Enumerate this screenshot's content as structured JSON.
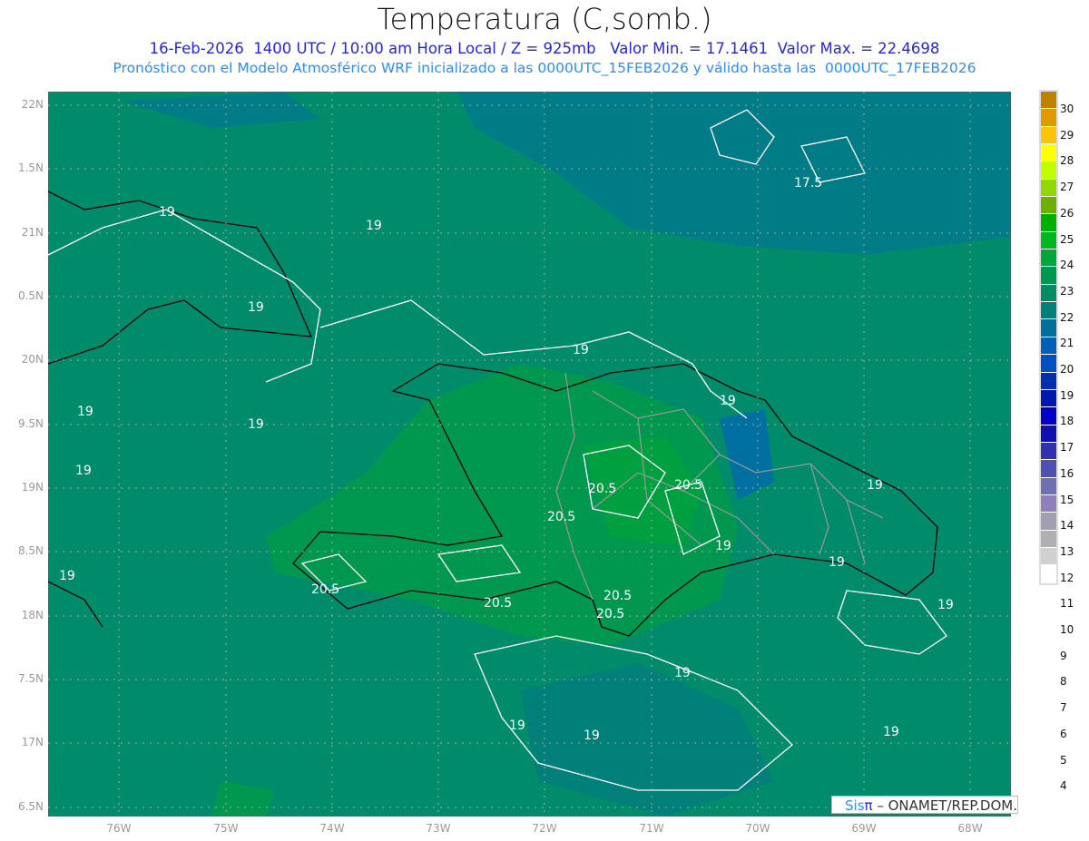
{
  "title": "Temperatura (C,somb.)",
  "subtitle1": "16-Feb-2026  1400 UTC / 10:00 am Hora Local / Z = 925mb   Valor Min. = 17.1461  Valor Max. = 22.4698",
  "subtitle2": "Pronóstico con el Modelo Atmosférico WRF inicializado a las 0000UTC_15FEB2026 y válido hasta las  0000UTC_17FEB2026",
  "lat_labels": [
    "22N",
    "1.5N",
    "21N",
    "0.5N",
    "20N",
    "9.5N",
    "19N",
    "8.5N",
    "18N",
    "7.5N",
    "17N",
    "6.5N"
  ],
  "lon_labels": [
    "76W",
    "75W",
    "74W",
    "73W",
    "72W",
    "71W",
    "70W",
    "69W",
    "68W"
  ],
  "colorbar": {
    "labels": [
      "30",
      "29",
      "28",
      "27",
      "26",
      "25",
      "24",
      "23",
      "22",
      "21",
      "20",
      "19",
      "18",
      "17",
      "16",
      "15",
      "14",
      "13",
      "12",
      "11",
      "10",
      "9",
      "8",
      "7",
      "6",
      "5",
      "4"
    ],
    "colors": [
      "#C08000",
      "#E09A00",
      "#FFC400",
      "#FFFF00",
      "#BFFF00",
      "#90D800",
      "#6CB000",
      "#00B000",
      "#00B81E",
      "#00A83C",
      "#00984E",
      "#008C64",
      "#008078",
      "#00709A",
      "#0060B8",
      "#0050C0",
      "#0030B0",
      "#0018B0",
      "#0000C8",
      "#1010B0",
      "#3030B0",
      "#5050B0",
      "#7070B0",
      "#9080B8",
      "#A0A0B0",
      "#B0B0B0",
      "#D0D0D0",
      "#FFFFFF"
    ]
  },
  "contour_labels": [
    "19",
    "19",
    "19",
    "19",
    "19",
    "19",
    "19",
    "19",
    "19",
    "19",
    "19",
    "19",
    "19",
    "19",
    "19",
    "19",
    "19",
    "17.5",
    "20.5",
    "20.5",
    "20.5",
    "20.5",
    "20.5",
    "20.5",
    "20.5"
  ],
  "credit": {
    "brand1": "Sis",
    "brand2": "π",
    "text": "– ONAMET/REP.DOM."
  }
}
